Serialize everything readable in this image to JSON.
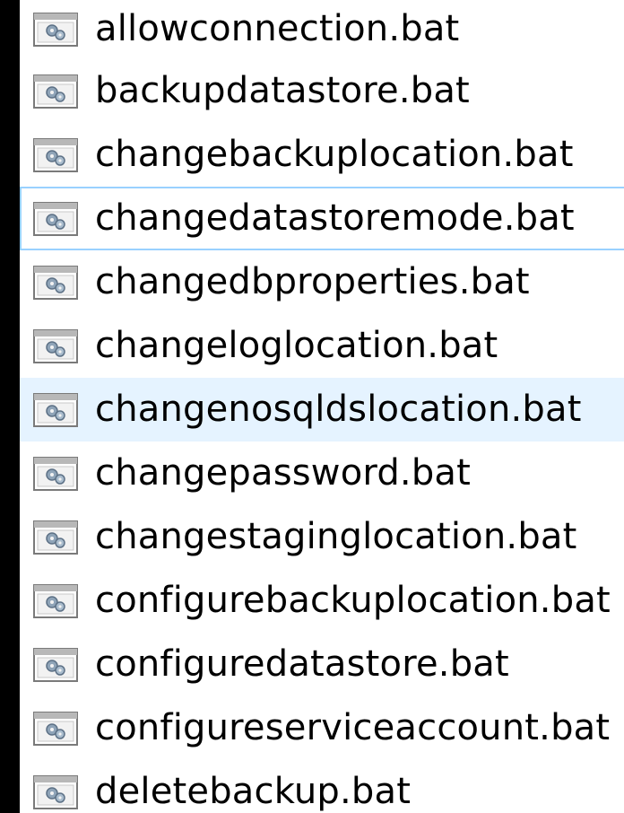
{
  "file_list": {
    "hover_index": 6,
    "focus_index": 3,
    "items": [
      {
        "name": "allowconnection.bat",
        "icon": "batch-file-icon"
      },
      {
        "name": "backupdatastore.bat",
        "icon": "batch-file-icon"
      },
      {
        "name": "changebackuplocation.bat",
        "icon": "batch-file-icon"
      },
      {
        "name": "changedatastoremode.bat",
        "icon": "batch-file-icon"
      },
      {
        "name": "changedbproperties.bat",
        "icon": "batch-file-icon"
      },
      {
        "name": "changeloglocation.bat",
        "icon": "batch-file-icon"
      },
      {
        "name": "changenosqldslocation.bat",
        "icon": "batch-file-icon"
      },
      {
        "name": "changepassword.bat",
        "icon": "batch-file-icon"
      },
      {
        "name": "changestaginglocation.bat",
        "icon": "batch-file-icon"
      },
      {
        "name": "configurebackuplocation.bat",
        "icon": "batch-file-icon"
      },
      {
        "name": "configuredatastore.bat",
        "icon": "batch-file-icon"
      },
      {
        "name": "configureserviceaccount.bat",
        "icon": "batch-file-icon"
      },
      {
        "name": "deletebackup.bat",
        "icon": "batch-file-icon"
      }
    ]
  },
  "colors": {
    "hover_background": "#e5f3ff",
    "focus_border": "#99d1ff",
    "outer_background": "#000000"
  }
}
